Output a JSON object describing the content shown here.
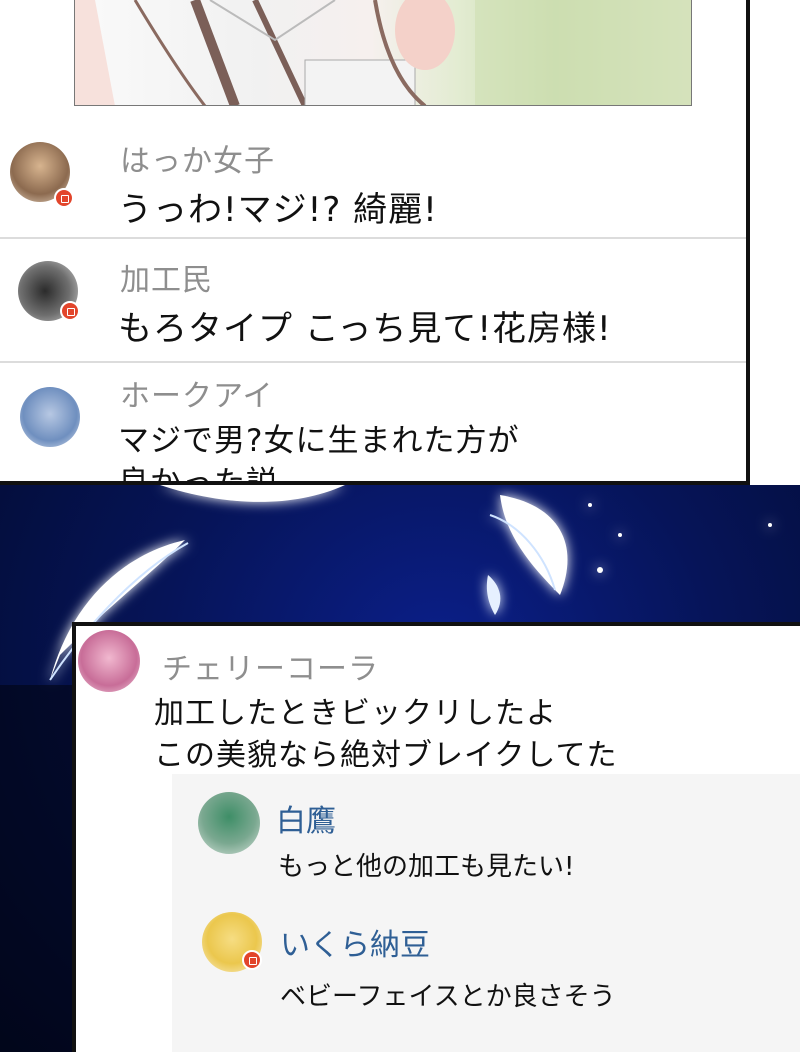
{
  "comments": [
    {
      "name": "はっか女子",
      "text": "うっわ!マジ!? 綺麗!",
      "avatar_color": "#c9a27e"
    },
    {
      "name": "加工民",
      "text": "もろタイプ こっち見て!花房様!",
      "avatar_color": "#4a4a4a"
    },
    {
      "name": "ホークアイ",
      "text_line1": "マジで男?女に生まれた方が",
      "text_line2": "良かった説",
      "avatar_color": "#8fa8cf"
    },
    {
      "name": "チェリーコーラ",
      "text_line1": "加工したときビックリしたよ",
      "text_line2": "この美貌なら絶対ブレイクしてた",
      "avatar_color": "#d98fb0"
    }
  ],
  "replies": [
    {
      "name": "白鷹",
      "text": "もっと他の加工も見たい!",
      "avatar_color": "#3f8a63"
    },
    {
      "name": "いくら納豆",
      "text": "ベビーフェイスとか良さそう",
      "avatar_color": "#f2cf63"
    }
  ],
  "colors": {
    "badge": "#e2452b",
    "reply_name": "#2f5f95",
    "name_gray": "#8e8e8e",
    "sky": "#061458"
  }
}
